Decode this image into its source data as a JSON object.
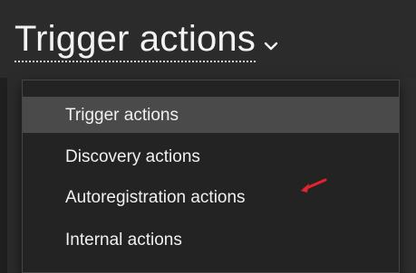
{
  "header": {
    "title": "Trigger actions",
    "dropdown_icon": "chevron-down-icon"
  },
  "menu": {
    "items": [
      {
        "label": "Trigger actions"
      },
      {
        "label": "Discovery actions"
      },
      {
        "label": "Autoregistration actions"
      },
      {
        "label": "Internal actions"
      }
    ]
  },
  "annotation": {
    "icon": "red-arrow-icon",
    "color": "#e5232b"
  },
  "colors": {
    "background": "#2b2b2b",
    "menu_background": "#232323",
    "active_item": "#4a4a4a",
    "text": "#f0f0f0"
  }
}
